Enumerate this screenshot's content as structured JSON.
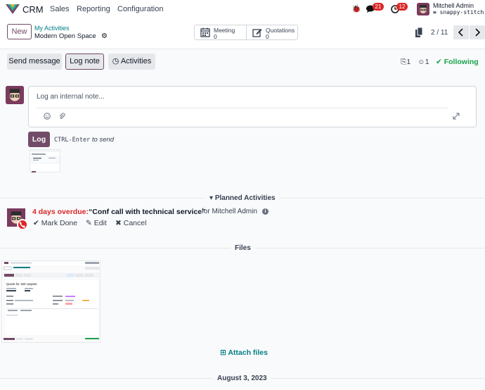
{
  "navbar": {
    "app_name": "CRM",
    "menus": [
      "Sales",
      "Reporting",
      "Configuration"
    ],
    "chat_count": "21",
    "activity_count": "12",
    "user_name": "Mitchell Admin",
    "database": "snappy-stitch"
  },
  "control_panel": {
    "new_label": "New",
    "breadcrumb_parent": "My Activities",
    "breadcrumb_current": "Modern Open Space",
    "smart_buttons": [
      {
        "label": "Meeting",
        "value": "0",
        "icon": "calendar-icon"
      },
      {
        "label": "Quotations",
        "value": "0",
        "icon": "pencil-square-icon"
      }
    ],
    "pager": "2 / 11"
  },
  "chatter": {
    "send_message": "Send message",
    "log_note": "Log note",
    "activities": "Activities",
    "attachments_count": "1",
    "followers_count": "1",
    "following_label": "Following",
    "composer_placeholder": "Log an internal note...",
    "log_button": "Log",
    "send_hint_key": "CTRL-Enter",
    "send_hint_text": "to send"
  },
  "planned": {
    "title": "Planned Activities",
    "overdue": "4 days overdue:",
    "summary": "“Conf call with technical service”",
    "for_user": "for Mitchell Admin",
    "mark_done": "Mark Done",
    "edit": "Edit",
    "cancel": "Cancel"
  },
  "files": {
    "title": "Files",
    "attach_label": "Attach files",
    "thumb_title": "Quote for 150 carpets"
  },
  "date_separator": "August 3, 2023",
  "colors": {
    "brand": "#714B67",
    "link": "#017e84",
    "danger": "#dc2626",
    "success": "#16a34a"
  }
}
